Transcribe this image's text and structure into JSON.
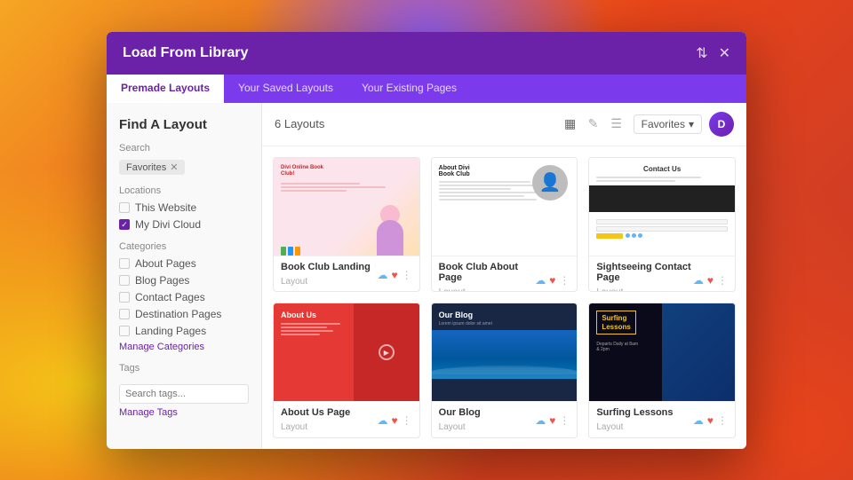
{
  "modal": {
    "title": "Load From Library",
    "close_label": "✕",
    "settings_label": "⇅"
  },
  "tabs": [
    {
      "label": "Premade Layouts",
      "active": true
    },
    {
      "label": "Your Saved Layouts",
      "active": false
    },
    {
      "label": "Your Existing Pages",
      "active": false
    }
  ],
  "sidebar": {
    "heading": "Find A Layout",
    "search_label": "Search",
    "search_tag": "Favorites",
    "locations_label": "Locations",
    "locations": [
      {
        "label": "This Website",
        "checked": false
      },
      {
        "label": "My Divi Cloud",
        "checked": true
      }
    ],
    "categories_label": "Categories",
    "categories": [
      "About Pages",
      "Blog Pages",
      "Contact Pages",
      "Destination Pages",
      "Landing Pages"
    ],
    "manage_categories": "Manage Categories",
    "tags_label": "Tags",
    "manage_tags": "Manage Tags"
  },
  "main": {
    "count_label": "6 Layouts",
    "sort_label": "Favorites",
    "view_grid_icon": "▦",
    "view_brush_icon": "✎",
    "view_list_icon": "☰",
    "user_initial": "D"
  },
  "layouts": [
    {
      "id": "book-club-landing",
      "name": "Book Club Landing",
      "type": "Layout",
      "thumb_type": "book-club-landing"
    },
    {
      "id": "book-club-about",
      "name": "Book Club About Page",
      "type": "Layout",
      "thumb_type": "book-club-about"
    },
    {
      "id": "sightseeing-contact",
      "name": "Sightseeing Contact Page",
      "type": "Layout",
      "thumb_type": "sightseeing-contact",
      "contact_us_text": "Contact Us"
    },
    {
      "id": "about-us",
      "name": "About Us Page",
      "type": "Layout",
      "thumb_type": "about-us"
    },
    {
      "id": "our-blog",
      "name": "Our Blog",
      "type": "Layout",
      "thumb_type": "our-blog"
    },
    {
      "id": "surfing-lessons",
      "name": "Surfing Lessons",
      "type": "Layout",
      "thumb_type": "surfing-lessons"
    }
  ]
}
